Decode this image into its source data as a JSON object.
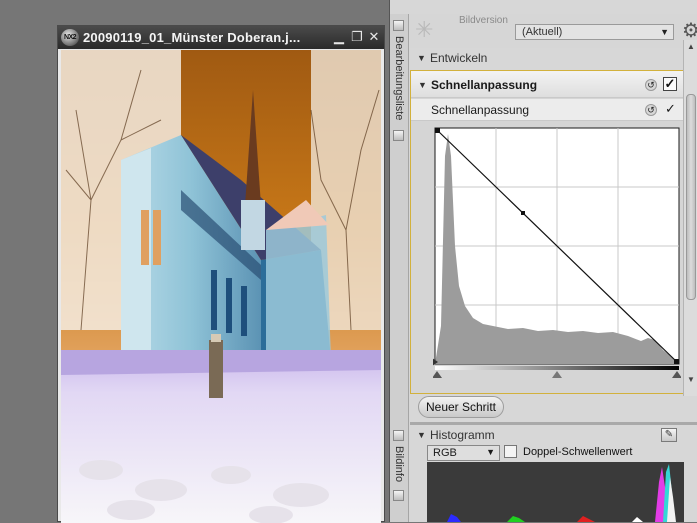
{
  "image_window": {
    "title": "20090119_01_Münster  Doberan.j...",
    "logo_text": "NX2",
    "min_label": "▁",
    "max_label": "❐",
    "close_label": "✕"
  },
  "panel": {
    "strip_label_top": "Bearbeitungsliste",
    "strip_label_bottom": "Bildinfo",
    "bildversion_label": "Bildversion",
    "version_value": "(Aktuell)",
    "entwickeln_label": "Entwickeln",
    "step_title": "Schnellanpassung",
    "sub_title": "Schnellanpassung",
    "new_step_button": "Neuer Schritt",
    "histogram_label": "Histogramm",
    "channel_value": "RGB",
    "threshold_label": "Doppel-Schwellenwert"
  },
  "icons": {
    "sparkle": "sparkle-icon",
    "gear": "gear-icon",
    "reset": "reset-icon",
    "check": "check-icon",
    "dropdown": "chevron-down-icon"
  },
  "colors": {
    "step_border": "#d2b13c",
    "title_bar": "#333333",
    "panel_bg": "#d7d7d7"
  }
}
